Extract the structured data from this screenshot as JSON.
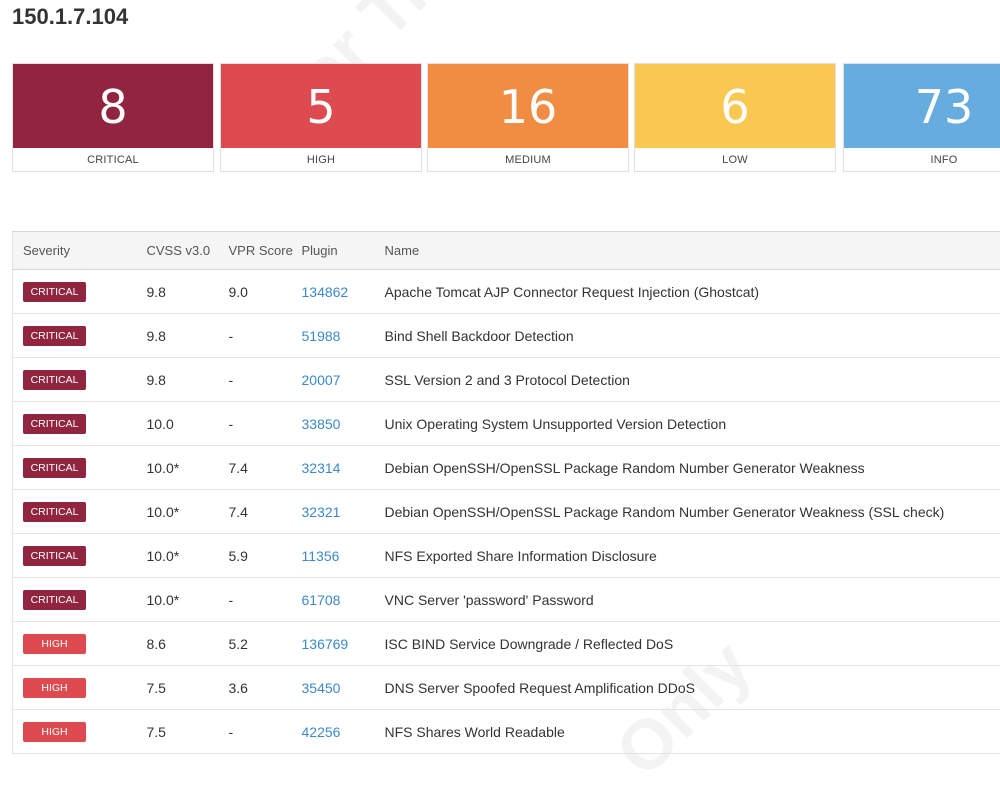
{
  "host": {
    "title": "150.1.7.104"
  },
  "summary": [
    {
      "count": "8",
      "label": "CRITICAL",
      "color": "#91243e"
    },
    {
      "count": "5",
      "label": "HIGH",
      "color": "#dd4b50"
    },
    {
      "count": "16",
      "label": "MEDIUM",
      "color": "#f18c43"
    },
    {
      "count": "6",
      "label": "LOW",
      "color": "#f8c851"
    },
    {
      "count": "73",
      "label": "INFO",
      "color": "#67acdf"
    }
  ],
  "table": {
    "headers": {
      "severity": "Severity",
      "cvss": "CVSS v3.0",
      "vpr": "VPR Score",
      "plugin": "Plugin",
      "name": "Name"
    },
    "rows": [
      {
        "severity": "CRITICAL",
        "cvss": "9.8",
        "vpr": "9.0",
        "plugin": "134862",
        "name": "Apache Tomcat AJP Connector Request Injection (Ghostcat)"
      },
      {
        "severity": "CRITICAL",
        "cvss": "9.8",
        "vpr": "-",
        "plugin": "51988",
        "name": "Bind Shell Backdoor Detection"
      },
      {
        "severity": "CRITICAL",
        "cvss": "9.8",
        "vpr": "-",
        "plugin": "20007",
        "name": "SSL Version 2 and 3 Protocol Detection"
      },
      {
        "severity": "CRITICAL",
        "cvss": "10.0",
        "vpr": "-",
        "plugin": "33850",
        "name": "Unix Operating System Unsupported Version Detection"
      },
      {
        "severity": "CRITICAL",
        "cvss": "10.0*",
        "vpr": "7.4",
        "plugin": "32314",
        "name": "Debian OpenSSH/OpenSSL Package Random Number Generator Weakness"
      },
      {
        "severity": "CRITICAL",
        "cvss": "10.0*",
        "vpr": "7.4",
        "plugin": "32321",
        "name": "Debian OpenSSH/OpenSSL Package Random Number Generator Weakness (SSL check)"
      },
      {
        "severity": "CRITICAL",
        "cvss": "10.0*",
        "vpr": "5.9",
        "plugin": "11356",
        "name": "NFS Exported Share Information Disclosure"
      },
      {
        "severity": "CRITICAL",
        "cvss": "10.0*",
        "vpr": "-",
        "plugin": "61708",
        "name": "VNC Server 'password' Password"
      },
      {
        "severity": "HIGH",
        "cvss": "8.6",
        "vpr": "5.2",
        "plugin": "136769",
        "name": "ISC BIND Service Downgrade / Reflected DoS"
      },
      {
        "severity": "HIGH",
        "cvss": "7.5",
        "vpr": "3.6",
        "plugin": "35450",
        "name": "DNS Server Spoofed Request Amplification DDoS"
      },
      {
        "severity": "HIGH",
        "cvss": "7.5",
        "vpr": "-",
        "plugin": "42256",
        "name": "NFS Shares World Readable"
      }
    ]
  },
  "severity_colors": {
    "CRITICAL": "#91243e",
    "HIGH": "#dd4b50"
  },
  "watermark": {
    "text_top": "For Tria",
    "text_bottom": "Only"
  }
}
